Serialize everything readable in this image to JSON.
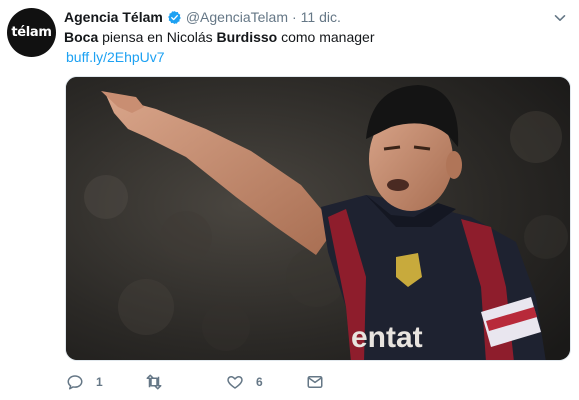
{
  "tweet": {
    "avatar_text": "télam",
    "author_name": "Agencia Télam",
    "verified_icon": "verified-badge-icon",
    "handle": "@AgenciaTelam",
    "separator": "·",
    "date": "11 dic.",
    "text_parts": [
      "Boca",
      " piensa en Nicolás ",
      "Burdisso",
      " como manager"
    ],
    "link": "buff.ly/2EhpUv7",
    "media_icon": "photo-soccer-player-pointing",
    "actions": {
      "reply_icon": "reply-icon",
      "reply_count": "1",
      "retweet_icon": "retweet-icon",
      "retweet_count": "",
      "like_icon": "heart-icon",
      "like_count": "6",
      "message_icon": "envelope-icon"
    },
    "menu_icon": "chevron-down-icon"
  },
  "colors": {
    "link": "#1da1f2",
    "secondary_text": "#657786",
    "verified": "#1da1f2",
    "primary_text": "#14171a"
  }
}
